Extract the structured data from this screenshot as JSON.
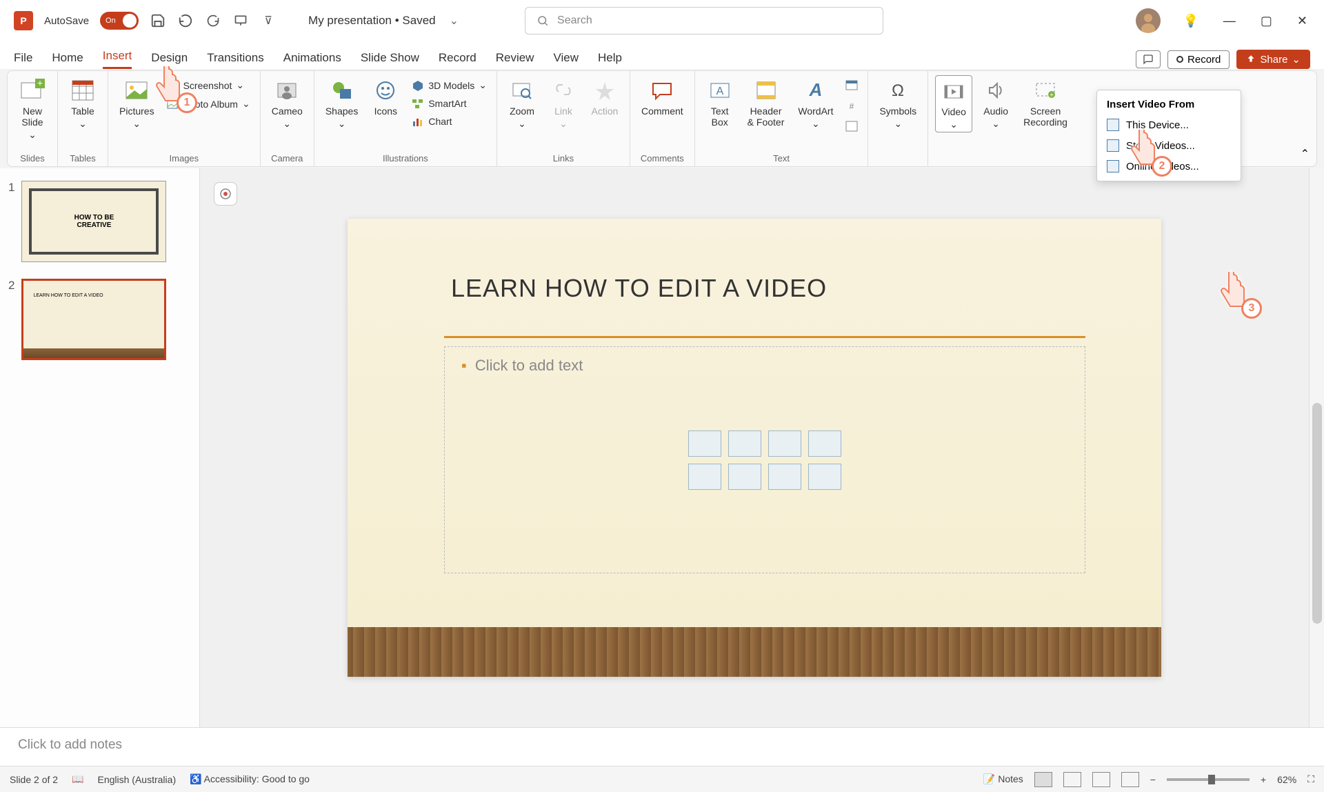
{
  "titlebar": {
    "autosave_label": "AutoSave",
    "autosave_state": "On",
    "doc_title": "My presentation • Saved",
    "search_placeholder": "Search"
  },
  "tabs": {
    "items": [
      "File",
      "Home",
      "Insert",
      "Design",
      "Transitions",
      "Animations",
      "Slide Show",
      "Record",
      "Review",
      "View",
      "Help"
    ],
    "active": "Insert",
    "record": "Record",
    "share": "Share"
  },
  "ribbon": {
    "groups": {
      "slides": {
        "label": "Slides",
        "new_slide": "New\nSlide"
      },
      "tables": {
        "label": "Tables",
        "table": "Table"
      },
      "images": {
        "label": "Images",
        "pictures": "Pictures",
        "screenshot": "Screenshot",
        "photo_album": "Photo Album"
      },
      "camera": {
        "label": "Camera",
        "cameo": "Cameo"
      },
      "illustrations": {
        "label": "Illustrations",
        "shapes": "Shapes",
        "icons": "Icons",
        "models": "3D Models",
        "smartart": "SmartArt",
        "chart": "Chart"
      },
      "links": {
        "label": "Links",
        "zoom": "Zoom",
        "link": "Link",
        "action": "Action"
      },
      "comments": {
        "label": "Comments",
        "comment": "Comment"
      },
      "text": {
        "label": "Text",
        "textbox": "Text\nBox",
        "header": "Header\n& Footer",
        "wordart": "WordArt"
      },
      "symbols": {
        "label": "",
        "symbols": "Symbols"
      },
      "media": {
        "label": "",
        "video": "Video",
        "audio": "Audio",
        "screen": "Screen\nRecording"
      }
    }
  },
  "video_dropdown": {
    "header": "Insert Video From",
    "items": [
      "This Device...",
      "Stock Videos...",
      "Online Videos..."
    ]
  },
  "slides": {
    "thumb1_title": "HOW TO BE\nCREATIVE",
    "thumb2_title": "LEARN HOW TO EDIT A VIDEO"
  },
  "canvas": {
    "title": "LEARN HOW TO EDIT A VIDEO",
    "placeholder": "Click to add text"
  },
  "notes": {
    "placeholder": "Click to add notes"
  },
  "statusbar": {
    "slide": "Slide 2 of 2",
    "lang": "English (Australia)",
    "access": "Accessibility: Good to go",
    "notes": "Notes",
    "zoom": "62%"
  },
  "tutorial": {
    "step1": "1",
    "step2": "2",
    "step3": "3"
  }
}
